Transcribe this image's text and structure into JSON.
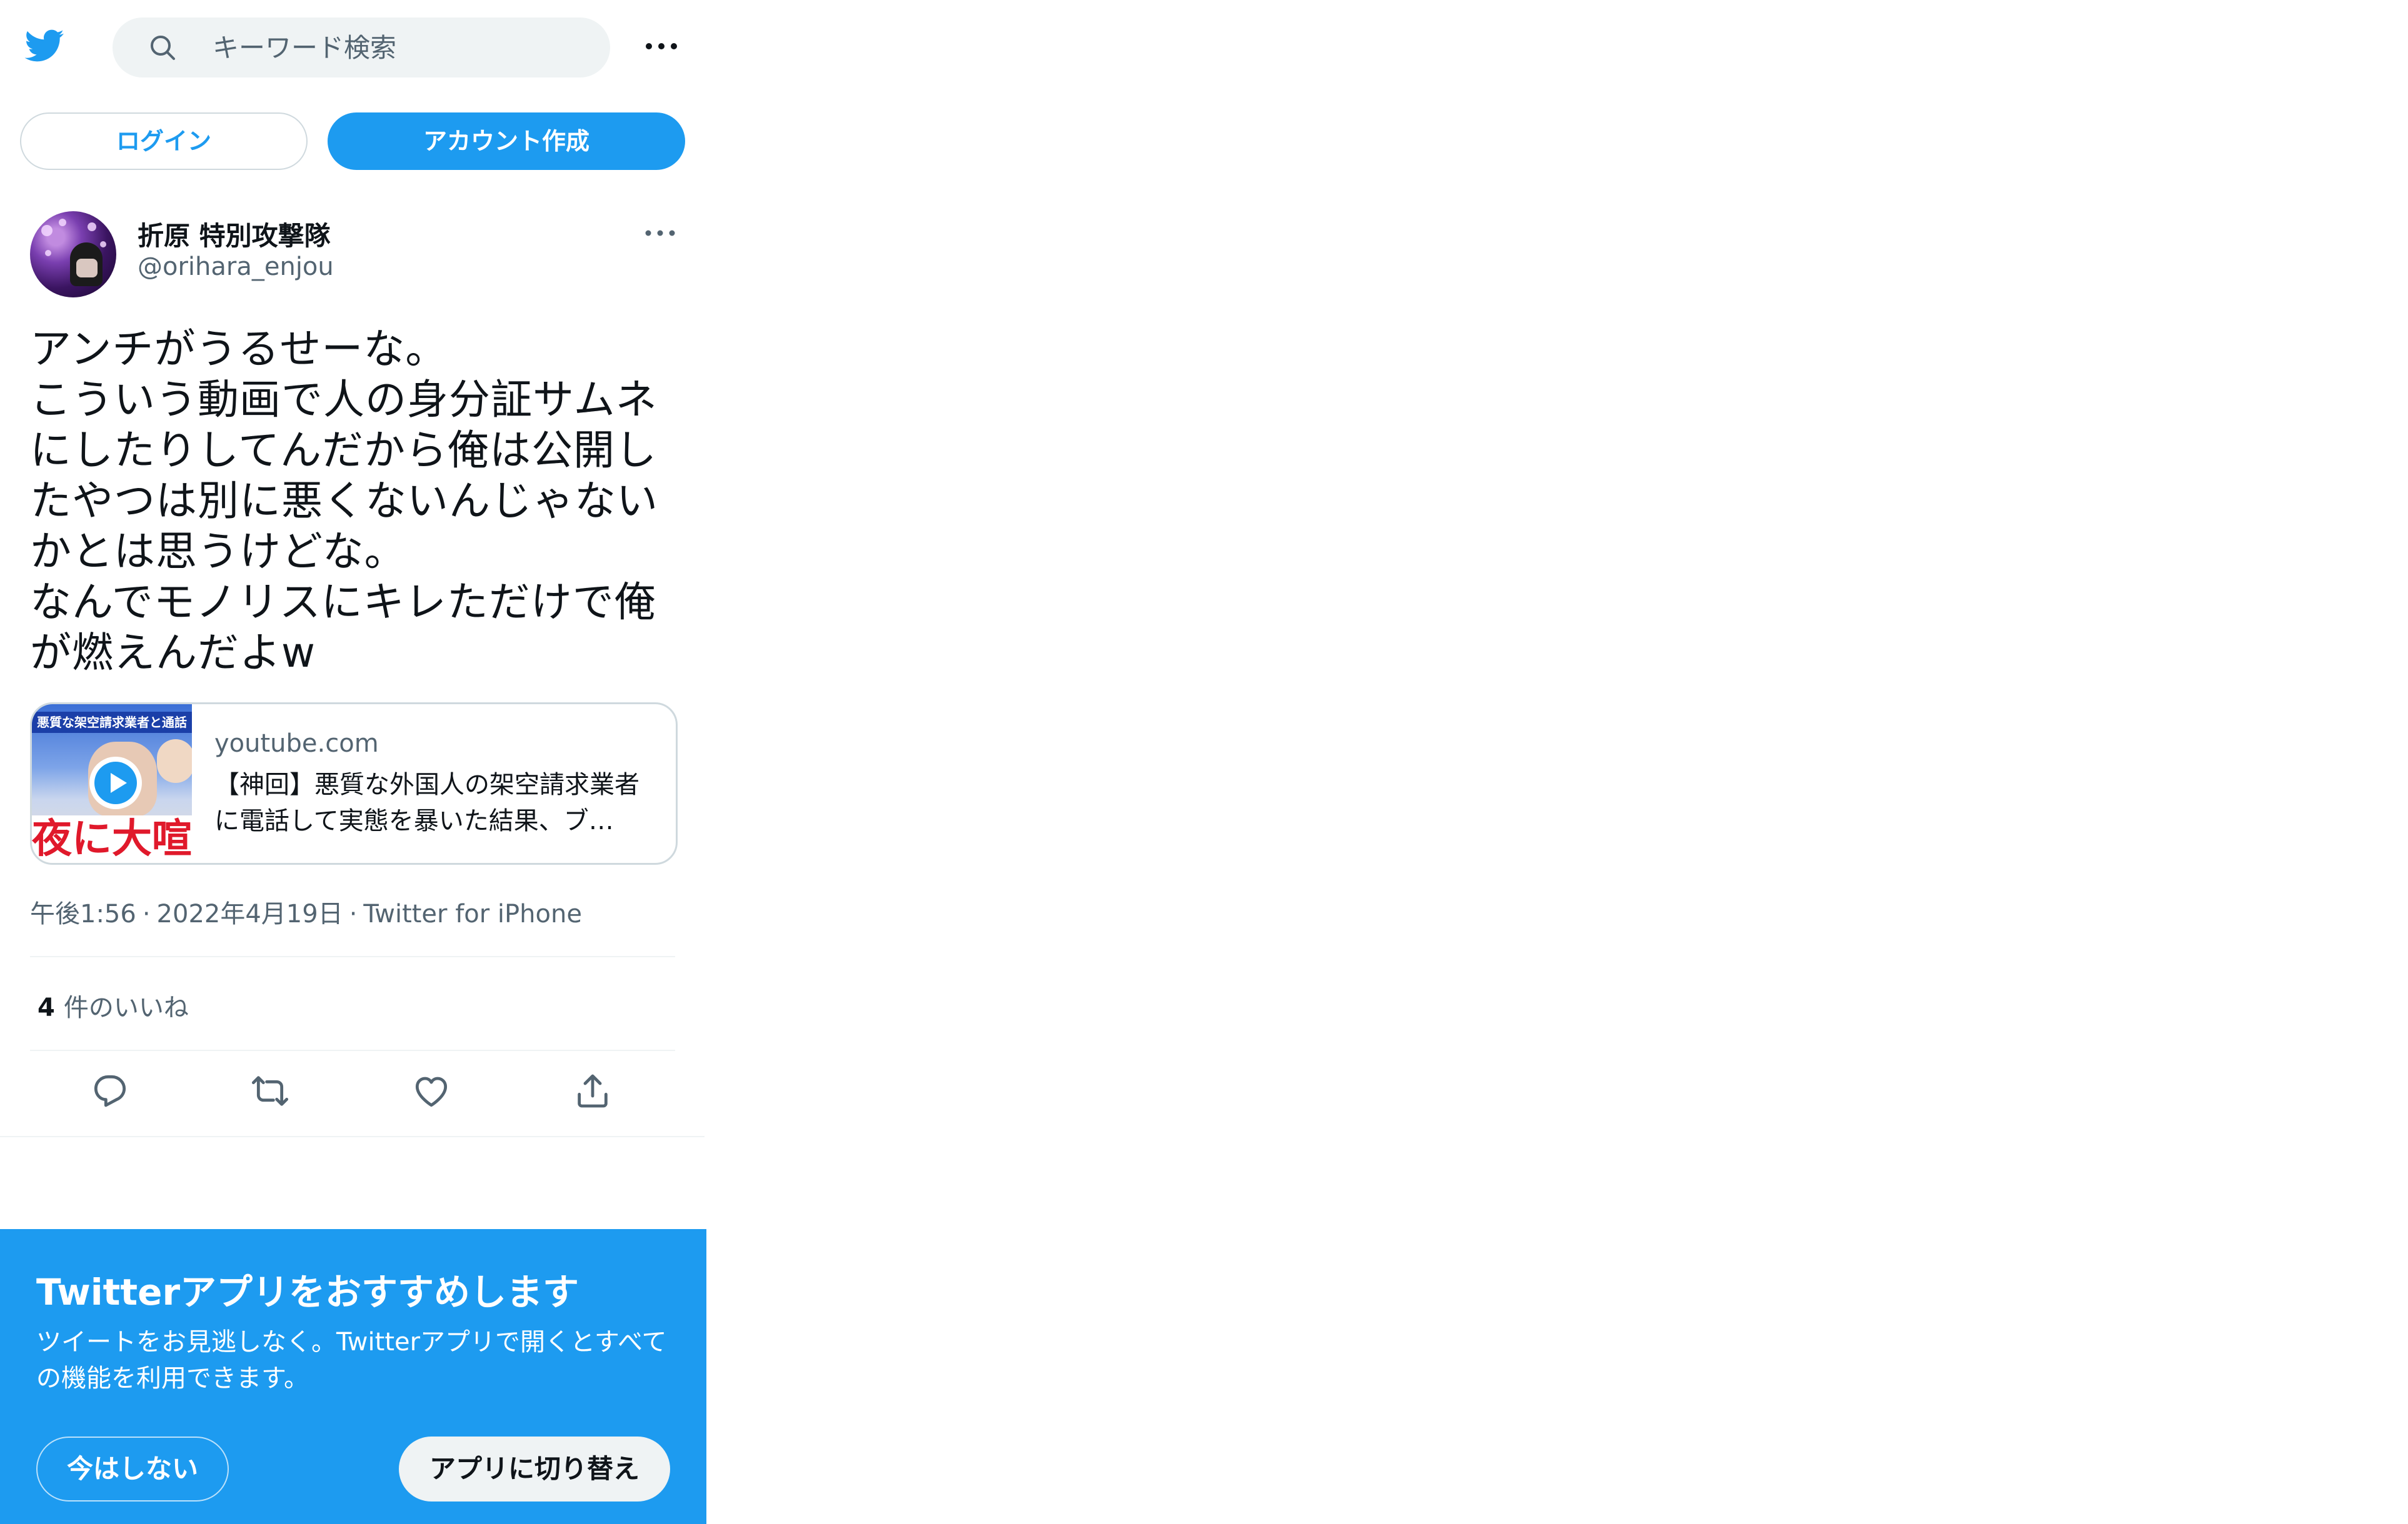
{
  "header": {
    "logo_icon": "twitter-bird-icon",
    "search_placeholder": "キーワード検索",
    "search_icon": "search-icon",
    "more_icon": "more-horizontal-icon"
  },
  "auth": {
    "login_label": "ログイン",
    "signup_label": "アカウント作成"
  },
  "tweet": {
    "display_name": "折原 特別攻撃隊",
    "handle": "@orihara_enjou",
    "text": "アンチがうるせーな。\nこういう動画で人の身分証サムネにしたりしてんだから俺は公開したやつは別に悪くないんじゃないかとは思うけどな。\nなんでモノリスにキレただけで俺が燃えんだよw",
    "card": {
      "domain": "youtube.com",
      "title": "【神回】悪質な外国人の架空請求業者に電話して実態を暴いた結果、ブ…",
      "thumb_banner": "悪質な架空請求業者と通話",
      "thumb_caption": "夜に大喧嘩"
    },
    "time": "午後1:56",
    "date": "2022年4月19日",
    "source": "Twitter for iPhone",
    "separator": "·",
    "likes_count": "4",
    "likes_label": "件のいいね"
  },
  "actions": [
    "reply-icon",
    "retweet-icon",
    "like-icon",
    "share-icon"
  ],
  "promo": {
    "title": "Twitterアプリをおすすめします",
    "body": "ツイートをお見逃しなく。Twitterアプリで開くとすべての機能を利用できます。",
    "later_label": "今はしない",
    "switch_label": "アプリに切り替え"
  },
  "colors": {
    "brand": "#1d9bf0",
    "text": "#0f1419",
    "secondary": "#536471",
    "border": "#cfd9de"
  }
}
